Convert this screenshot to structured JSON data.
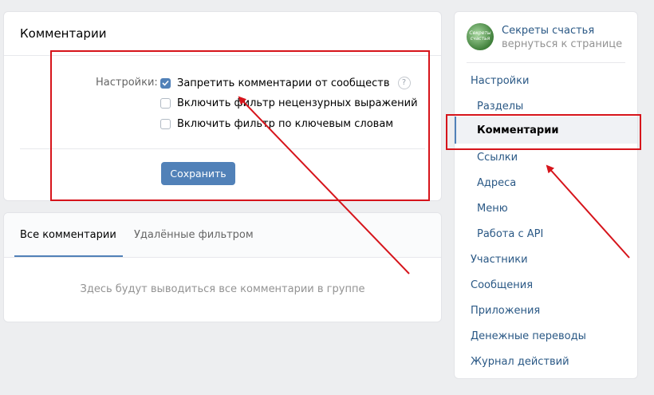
{
  "settings": {
    "title": "Комментарии",
    "label": "Настройки:",
    "options": [
      {
        "label": "Запретить комментарии от сообществ",
        "checked": true
      },
      {
        "label": "Включить фильтр нецензурных выражений",
        "checked": false
      },
      {
        "label": "Включить фильтр по ключевым словам",
        "checked": false
      }
    ],
    "help": "?",
    "save_label": "Сохранить"
  },
  "comments": {
    "tabs": [
      "Все комментарии",
      "Удалённые фильтром"
    ],
    "empty_message": "Здесь будут выводиться все комментарии в группе"
  },
  "group": {
    "avatar_text": "Секреты счастья",
    "name": "Секреты счастья",
    "back_link": "вернуться к странице"
  },
  "nav": {
    "settings": "Настройки",
    "sub": [
      "Разделы",
      "Комментарии",
      "Ссылки",
      "Адреса",
      "Меню",
      "Работа с API"
    ],
    "items": [
      "Участники",
      "Сообщения",
      "Приложения",
      "Денежные переводы",
      "Журнал действий"
    ]
  },
  "colors": {
    "accent": "#5181b8",
    "link": "#2a5885",
    "annotation": "#d6141b"
  }
}
